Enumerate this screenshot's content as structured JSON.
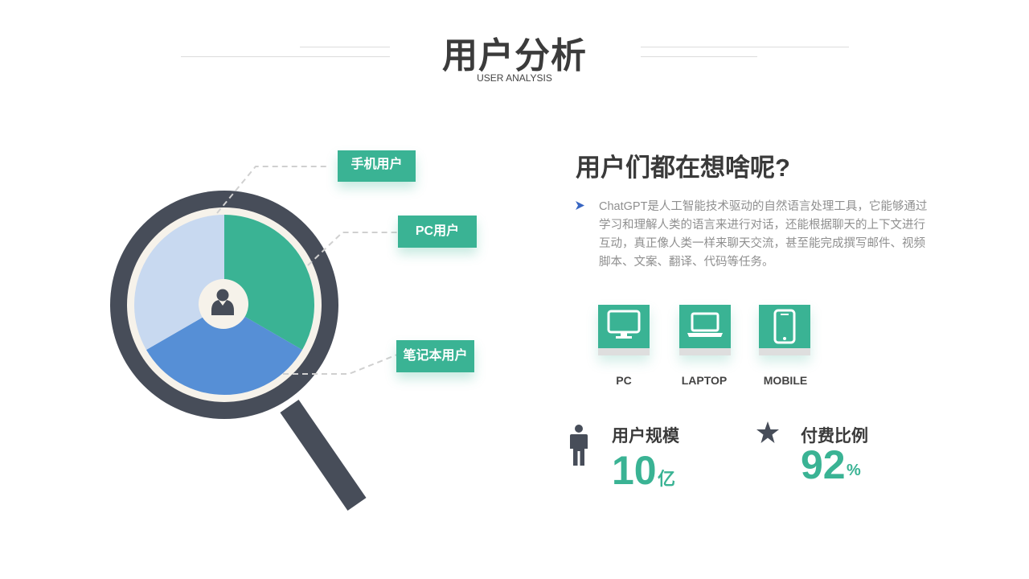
{
  "header": {
    "title": "用户分析",
    "subtitle": "USER ANALYSIS"
  },
  "colors": {
    "accent": "#3ab394",
    "dark": "#474d59",
    "light_blue": "#c8d9f0",
    "mid_blue": "#568fd6",
    "cream": "#f6f2ea"
  },
  "graphic": {
    "center_icon": "user-icon",
    "tags": [
      {
        "label": "手机用户"
      },
      {
        "label": "PC用户"
      },
      {
        "label": "笔记本用户"
      }
    ]
  },
  "content": {
    "heading": "用户们都在想啥呢?",
    "bullet_icon": "arrow-bullet-icon",
    "paragraph": "ChatGPT是人工智能技术驱动的自然语言处理工具，它能够通过学习和理解人类的语言来进行对话，还能根据聊天的上下文进行互动，真正像人类一样来聊天交流，甚至能完成撰写邮件、视频脚本、文案、翻译、代码等任务。"
  },
  "devices": [
    {
      "label": "PC",
      "icon": "monitor-icon"
    },
    {
      "label": "LAPTOP",
      "icon": "laptop-icon"
    },
    {
      "label": "MOBILE",
      "icon": "mobile-icon"
    }
  ],
  "stats": [
    {
      "label": "用户规模",
      "value": "10",
      "unit": "亿",
      "icon": "person-icon"
    },
    {
      "label": "付费比例",
      "value": "92",
      "unit": "%",
      "icon": "star-icon"
    }
  ]
}
